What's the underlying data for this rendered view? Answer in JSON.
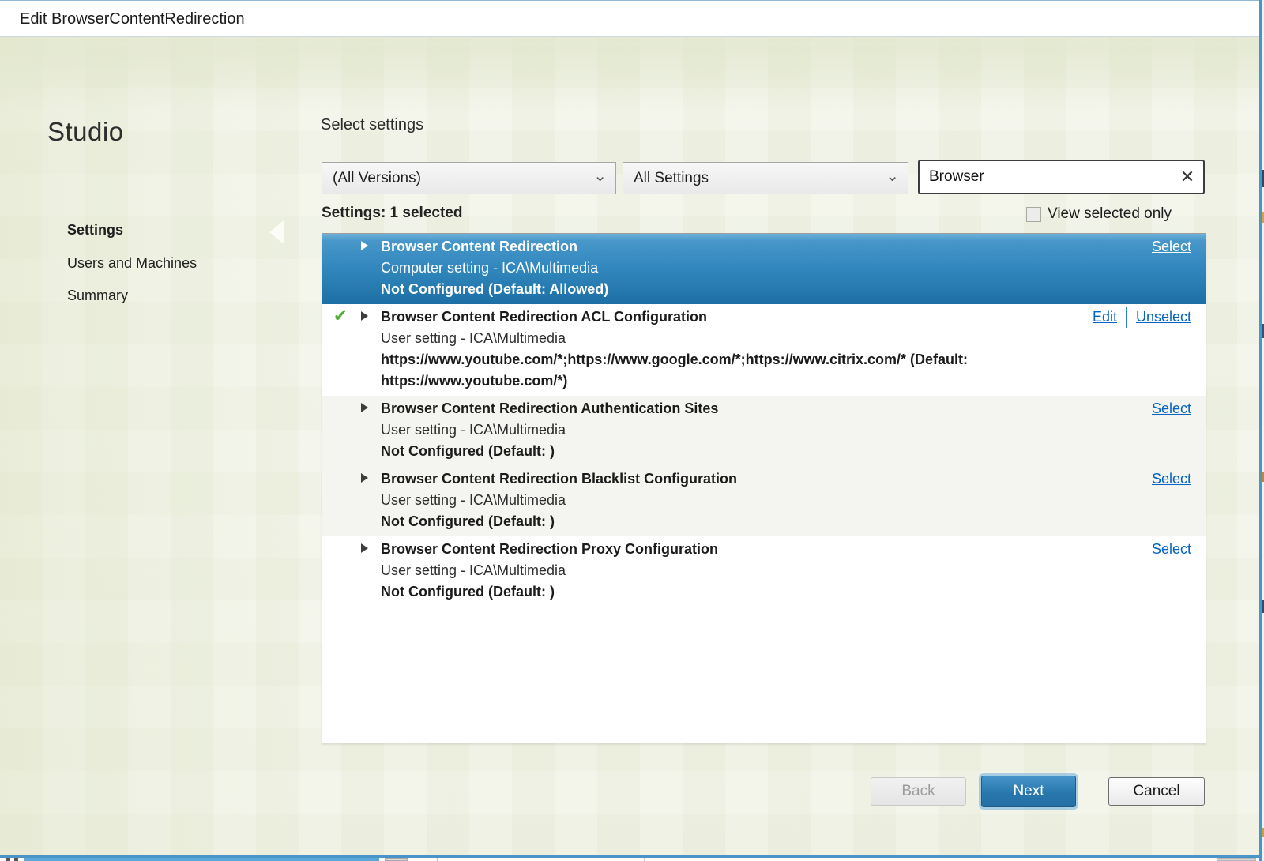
{
  "window": {
    "title": "Edit BrowserContentRedirection"
  },
  "sidebar": {
    "brand": "Studio",
    "items": [
      {
        "label": "Settings",
        "active": true
      },
      {
        "label": "Users and Machines",
        "active": false
      },
      {
        "label": "Summary",
        "active": false
      }
    ]
  },
  "header": {
    "heading": "Select settings"
  },
  "filters": {
    "version_dropdown": {
      "value": "(All Versions)"
    },
    "category_dropdown": {
      "value": "All Settings"
    },
    "search": {
      "value": "Browser",
      "placeholder": ""
    }
  },
  "status": {
    "selected_summary": "Settings: 1 selected",
    "view_selected_only_label": "View selected only",
    "view_selected_only_checked": false
  },
  "settings_list": {
    "rows": [
      {
        "title": "Browser Content Redirection",
        "scope": "Computer setting - ICA\\Multimedia",
        "value": "Not Configured (Default: Allowed)",
        "selected_row": true,
        "checked": false,
        "actions": [
          "Select"
        ]
      },
      {
        "title": "Browser Content Redirection ACL Configuration",
        "scope": "User setting - ICA\\Multimedia",
        "value": "https://www.youtube.com/*;https://www.google.com/*;https://www.citrix.com/* (Default: https://www.youtube.com/*)",
        "selected_row": false,
        "checked": true,
        "actions": [
          "Edit",
          "Unselect"
        ]
      },
      {
        "title": "Browser Content Redirection Authentication Sites",
        "scope": "User setting - ICA\\Multimedia",
        "value": "Not Configured (Default: )",
        "selected_row": false,
        "checked": false,
        "actions": [
          "Select"
        ]
      },
      {
        "title": "Browser Content Redirection Blacklist Configuration",
        "scope": "User setting - ICA\\Multimedia",
        "value": "Not Configured (Default: )",
        "selected_row": false,
        "checked": false,
        "actions": [
          "Select"
        ]
      },
      {
        "title": "Browser Content Redirection Proxy Configuration",
        "scope": "User setting - ICA\\Multimedia",
        "value": "Not Configured (Default: )",
        "selected_row": false,
        "checked": false,
        "actions": [
          "Select"
        ]
      }
    ]
  },
  "footer": {
    "back_label": "Back",
    "next_label": "Next",
    "cancel_label": "Cancel"
  },
  "icons": {
    "chevron_down": "⌄",
    "clear": "✕",
    "check": "✔"
  },
  "colors": {
    "accent_blue": "#2d7db8",
    "selected_row_top": "#5aa7d4",
    "selected_row_bottom": "#1d6fa5",
    "link_blue": "#0563c1",
    "check_green": "#4cae32"
  }
}
